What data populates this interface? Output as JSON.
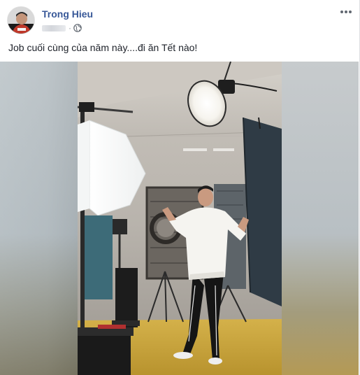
{
  "post": {
    "author": "Trong Hieu",
    "caption": "Job cuối cùng của năm này....đi ăn Tết nào!",
    "privacy_icon": "globe-icon",
    "more_icon": "ellipsis-icon"
  },
  "media": {
    "type": "video",
    "subject": "studio-dance-video"
  },
  "colors": {
    "author_link": "#385898",
    "text": "#1d2129",
    "meta": "#90949c",
    "floor": "#c9a640"
  }
}
